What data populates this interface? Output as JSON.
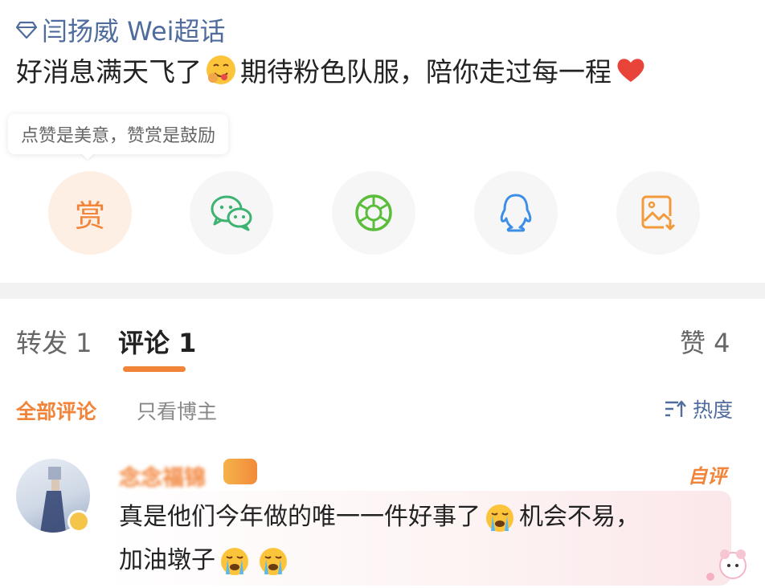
{
  "post": {
    "topic_icon": "diamond-icon",
    "topic": "闫扬威 Wei超话",
    "text_part1": "好消息满天飞了",
    "text_part2": "期待粉色队服，陪你走过每一程",
    "emoji1": "yum-face-emoji",
    "emoji2": "red-heart-emoji"
  },
  "reward_tip": "点赞是美意，赞赏是鼓励",
  "share": {
    "reward_label": "赏",
    "icons": [
      "wechat-icon",
      "moments-icon",
      "qq-icon",
      "save-image-icon"
    ]
  },
  "tabs": {
    "repost": "转发 1",
    "comment": "评论 1",
    "like": "赞 4"
  },
  "filters": {
    "all": "全部评论",
    "owner_only": "只看博主",
    "sort": "热度"
  },
  "comment": {
    "nickname": "念念福锦",
    "self_tag": "自评",
    "text_line1": "真是他们今年做的唯一一件好事了",
    "text_line1_end": "机会不易，",
    "text_line2": "加油墩子",
    "emoji": "crying-face-emoji"
  },
  "colors": {
    "accent": "#f2843a",
    "link": "#4f6c9c",
    "wechat": "#3cb371",
    "moments": "#5cbd3c",
    "qq": "#3d8ee6"
  }
}
